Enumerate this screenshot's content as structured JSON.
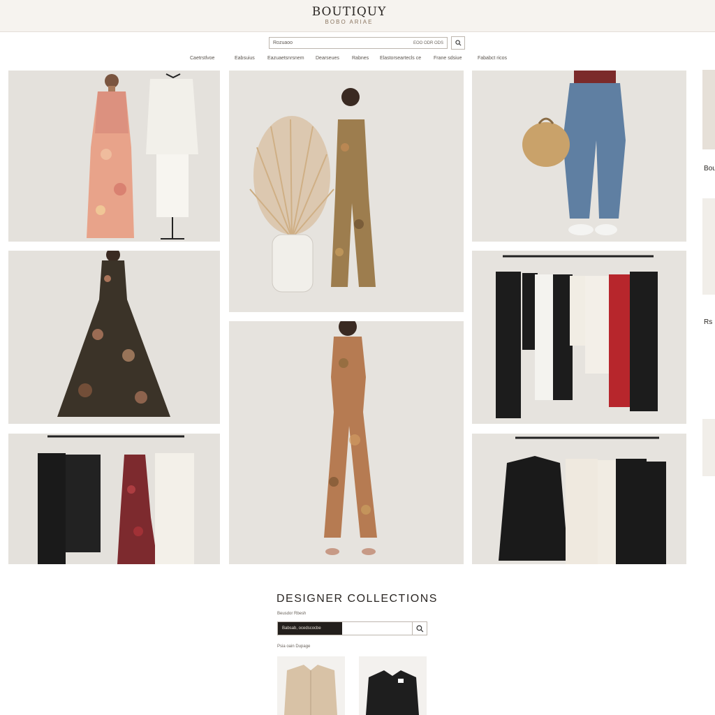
{
  "header": {
    "logo": "BOUTIQUY",
    "tagline": "BOBO ARIAE"
  },
  "search": {
    "placeholder": "Rozuaoo",
    "hint": "EOO ODR ODS",
    "button_icon": "search-icon"
  },
  "nav": {
    "items": [
      "Caetrstlvoe",
      "Eabsuius",
      "Eazuaetsnrsnem",
      "Dearseues",
      "Rabnes",
      "Elastorseartecls ce",
      "Frane sdsiue",
      "Fababct ricos"
    ]
  },
  "products": [
    {
      "name": "floral-maxi-dress-with-white-blazer",
      "colors": [
        "#e8a38a",
        "#f2f0ea"
      ]
    },
    {
      "name": "printed-jumpsuit-with-pampas-grass",
      "colors": [
        "#9d7d4e",
        "#d4b38a"
      ]
    },
    {
      "name": "denim-jeans-with-woven-bag",
      "colors": [
        "#5f7fa2",
        "#7b2a2a"
      ]
    },
    {
      "name": "floral-gown-dark",
      "colors": [
        "#3b3328",
        "#c58466"
      ]
    },
    {
      "name": "floral-wide-leg-jumpsuit",
      "colors": [
        "#b67b52",
        "#8a6a3a"
      ]
    },
    {
      "name": "clothing-rack-mixed",
      "colors": [
        "#1c1c1c",
        "#b7262c"
      ]
    },
    {
      "name": "rack-black-red-dress-white-coat",
      "colors": [
        "#1a1a1a",
        "#7d2a2e"
      ]
    },
    {
      "name": "rack-black-blazer-white-coat",
      "colors": [
        "#1a1a1a",
        "#efe9df"
      ]
    }
  ],
  "rail": {
    "label_1": "Bou",
    "label_2": "Rs"
  },
  "collections": {
    "title": "DESIGNER COLLECTIONS",
    "subtitle": "Beusdor Rbesh",
    "input_value": "Babsab, ocedscocbe",
    "section_label": "Psia oain Dupage",
    "items": [
      {
        "name": "beige-blazer",
        "color": "#d8c2a6"
      },
      {
        "name": "black-blazer",
        "color": "#1e1e1e"
      }
    ]
  }
}
